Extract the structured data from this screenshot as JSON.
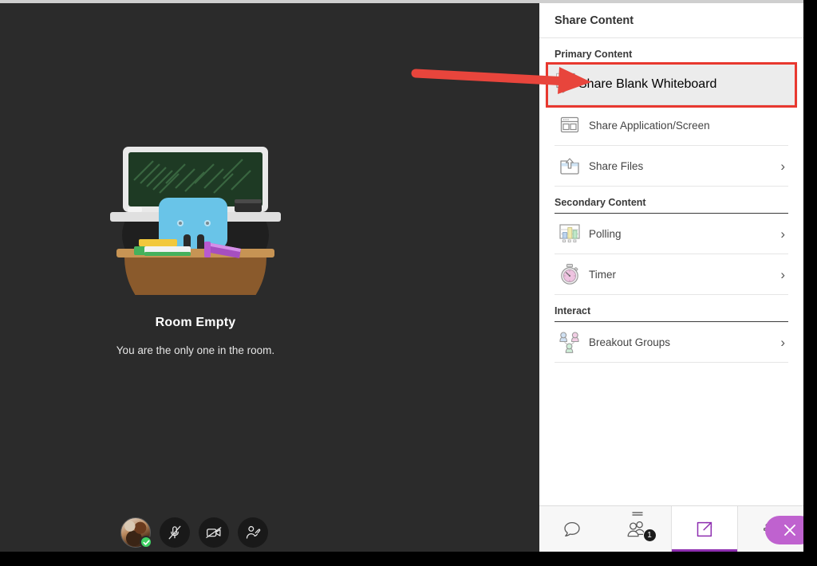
{
  "stage": {
    "empty_title": "Room Empty",
    "empty_subtitle": "You are the only one in the room.",
    "illustration_name": "empty-classroom-illustration",
    "self_controls": [
      {
        "name": "avatar",
        "icon": "user-avatar",
        "status": "connected-check"
      },
      {
        "name": "microphone-toggle",
        "icon": "mic-muted-icon"
      },
      {
        "name": "camera-toggle",
        "icon": "camera-off-icon"
      },
      {
        "name": "raise-hand",
        "icon": "raise-hand-icon"
      }
    ]
  },
  "panel": {
    "title": "Share Content",
    "sections": [
      {
        "label": "Primary Content",
        "items": [
          {
            "label": "Share Blank Whiteboard",
            "icon": "whiteboard-icon",
            "chevron": false,
            "highlighted": true
          },
          {
            "label": "Share Application/Screen",
            "icon": "screen-share-icon",
            "chevron": false,
            "highlighted": false
          },
          {
            "label": "Share Files",
            "icon": "folder-upload-icon",
            "chevron": true,
            "highlighted": false
          }
        ]
      },
      {
        "label": "Secondary Content",
        "items": [
          {
            "label": "Polling",
            "icon": "bar-chart-icon",
            "chevron": true,
            "highlighted": false
          },
          {
            "label": "Timer",
            "icon": "stopwatch-icon",
            "chevron": true,
            "highlighted": false
          }
        ]
      },
      {
        "label": "Interact",
        "items": [
          {
            "label": "Breakout Groups",
            "icon": "people-group-icon",
            "chevron": true,
            "highlighted": false
          }
        ]
      }
    ],
    "chevron_glyph": "›"
  },
  "tabbar": {
    "tabs": [
      {
        "name": "chat-tab",
        "icon": "chat-bubble-icon",
        "active": false,
        "badge": ""
      },
      {
        "name": "participants-tab",
        "icon": "people-icon",
        "active": false,
        "badge": "1"
      },
      {
        "name": "share-tab",
        "icon": "share-screen-icon",
        "active": true,
        "badge": ""
      },
      {
        "name": "settings-tab",
        "icon": "gear-icon",
        "active": false,
        "badge": ""
      }
    ],
    "close_label": "close-panel",
    "close_icon": "close-x-icon"
  },
  "annotation": {
    "name": "red-arrow-pointer",
    "color": "#e8382f",
    "points_to": "Share Blank Whiteboard"
  },
  "colors": {
    "accent_purple": "#8e2fb0",
    "close_pill": "#bf62cf",
    "highlight_red": "#e8382f",
    "stage_bg": "#2b2b2b",
    "panel_bg": "#ffffff"
  }
}
